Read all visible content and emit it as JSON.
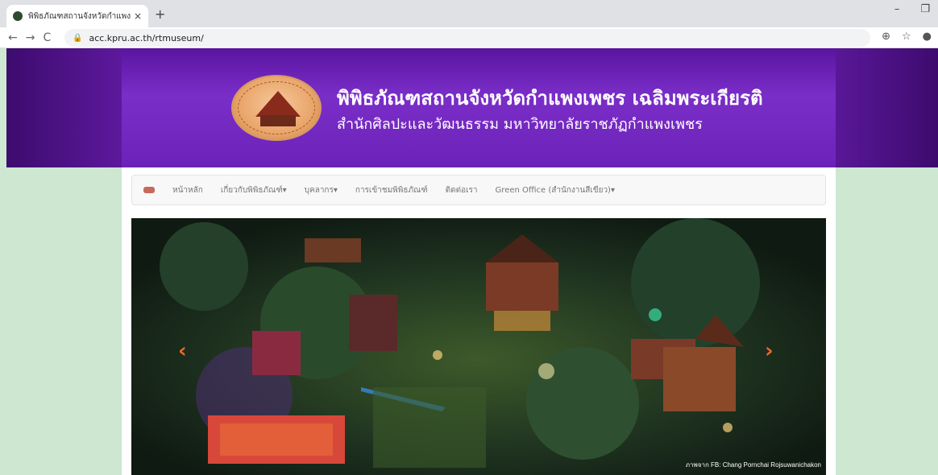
{
  "browser": {
    "tab_title": "พิพิธภัณฑสถานจังหวัดกำแพงเพชร เฉ",
    "tab_close": "×",
    "new_tab": "+",
    "url": "acc.kpru.ac.th/rtmuseum/",
    "back": "←",
    "forward": "→",
    "reload": "C",
    "lock": "🔒",
    "star": "☆",
    "extension": "⊕",
    "profile": "●",
    "minimize": "–",
    "restore": "❐"
  },
  "header": {
    "title": "พิพิธภัณฑสถานจังหวัดกำแพงเพชร เฉลิมพระเกียรติ",
    "subtitle": "สำนักศิลปะและวัฒนธรรม มหาวิทยาลัยราชภัฏกำแพงเพชร"
  },
  "nav": {
    "items": [
      "หน้าหลัก",
      "เกี่ยวกับพิพิธภัณฑ์▾",
      "บุคลากร▾",
      "การเข้าชมพิพิธภัณฑ์",
      "ติดต่อเรา",
      "Green Office (สำนักงานสีเขียว)▾"
    ]
  },
  "slider": {
    "prev": "‹",
    "next": "›",
    "credit": "ภาพจาก FB: Chang Pornchai Rojsuwanichakon"
  },
  "colors": {
    "page_bg": "#cde7d1",
    "banner": "#6b1fb1",
    "arrow": "#e9692c"
  }
}
